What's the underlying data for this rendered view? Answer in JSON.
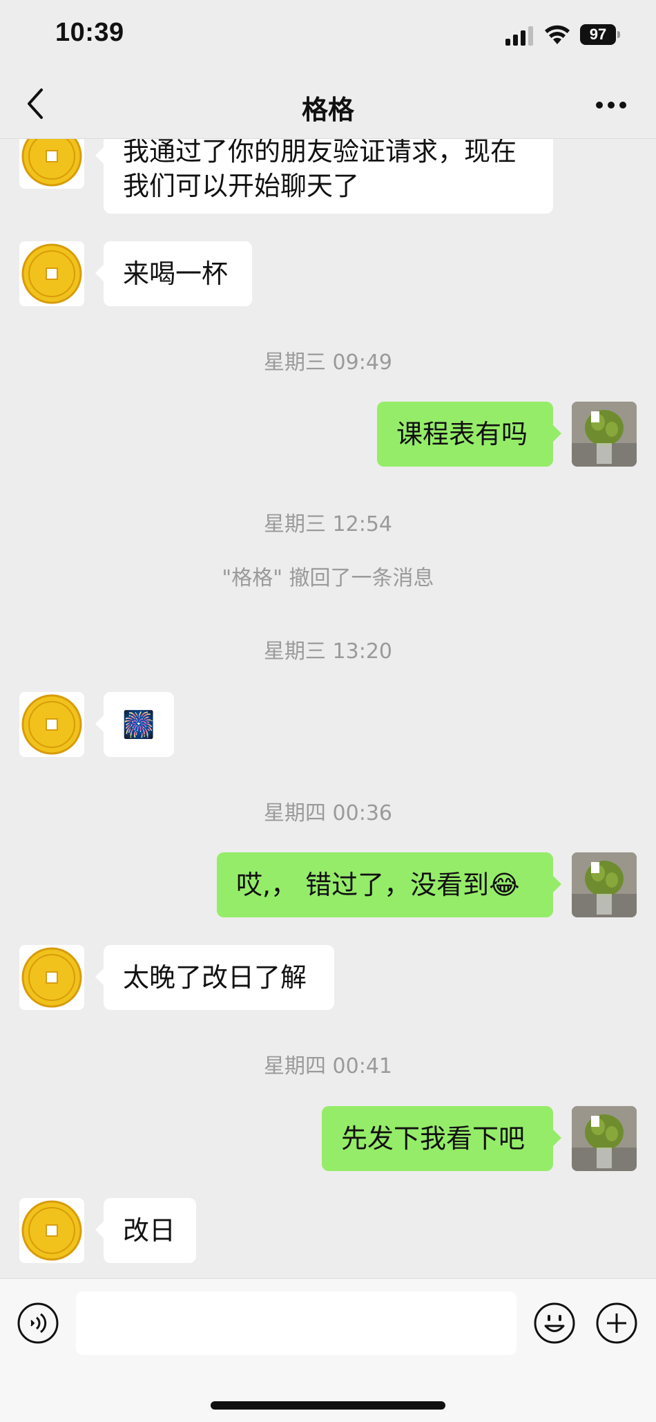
{
  "status_bar": {
    "time": "10:39",
    "battery": "97"
  },
  "nav": {
    "title": "格格",
    "back_icon": "chevron-left-icon",
    "more_icon": "more-dots-icon"
  },
  "messages": [
    {
      "side": "in",
      "text": "我通过了你的朋友验证请求，现在我们可以开始聊天了"
    },
    {
      "side": "in",
      "text": "来喝一杯"
    },
    {
      "stamp": "星期三 09:49"
    },
    {
      "side": "out",
      "text": "课程表有吗"
    },
    {
      "stamp": "星期三 12:54"
    },
    {
      "stamp": "\"格格\" 撤回了一条消息"
    },
    {
      "stamp": "星期三 13:20"
    },
    {
      "side": "in",
      "text": "🎆"
    },
    {
      "stamp": "星期四 00:36"
    },
    {
      "side": "out",
      "text": "哎,， 错过了，没看到😂"
    },
    {
      "side": "in",
      "text": "太晚了改日了解"
    },
    {
      "stamp": "星期四 00:41"
    },
    {
      "side": "out",
      "text": "先发下我看下吧"
    },
    {
      "side": "in",
      "text": "改日"
    }
  ],
  "composer": {
    "value": "",
    "voice_icon": "voice-icon",
    "emoji_icon": "emoji-icon",
    "plus_icon": "plus-icon"
  },
  "colors": {
    "background": "#ededed",
    "outgoing_bubble": "#95ec69",
    "incoming_bubble": "#ffffff",
    "timestamp": "#9a9a9a"
  }
}
